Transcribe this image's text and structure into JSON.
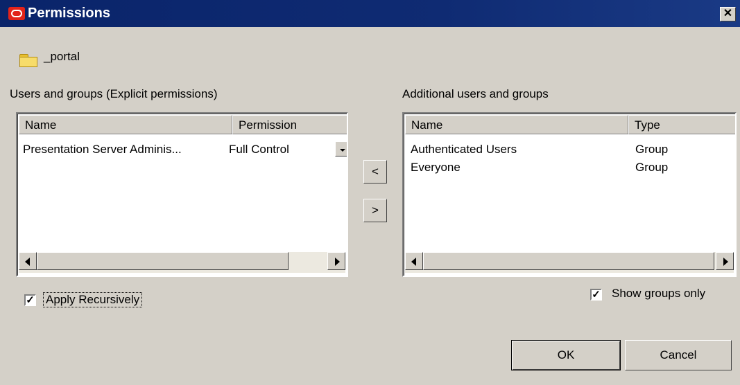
{
  "window": {
    "title": "Permissions",
    "close_glyph": "✕"
  },
  "folder": {
    "icon": "folder-icon",
    "name": "_portal"
  },
  "left_panel": {
    "label": "Users and groups (Explicit permissions)",
    "columns": [
      "Name",
      "Permission"
    ],
    "rows": [
      {
        "name": "Presentation Server Adminis...",
        "permission": "Full Control"
      }
    ]
  },
  "right_panel": {
    "label": "Additional users and groups",
    "columns": [
      "Name",
      "Type"
    ],
    "rows": [
      {
        "name": "Authenticated Users",
        "type": "Group"
      },
      {
        "name": "Everyone",
        "type": "Group"
      }
    ]
  },
  "move": {
    "left_label": "<",
    "right_label": ">"
  },
  "apply_recursively": {
    "label": "Apply Recursively",
    "checked": true,
    "mark": "✓"
  },
  "show_groups_only": {
    "label": "Show groups only",
    "checked": true,
    "mark": "✓"
  },
  "buttons": {
    "ok": "OK",
    "cancel": "Cancel"
  },
  "colors": {
    "titlebar": "#0a246a",
    "dialog": "#d4d0c8",
    "oracle_red": "#e2231a"
  }
}
